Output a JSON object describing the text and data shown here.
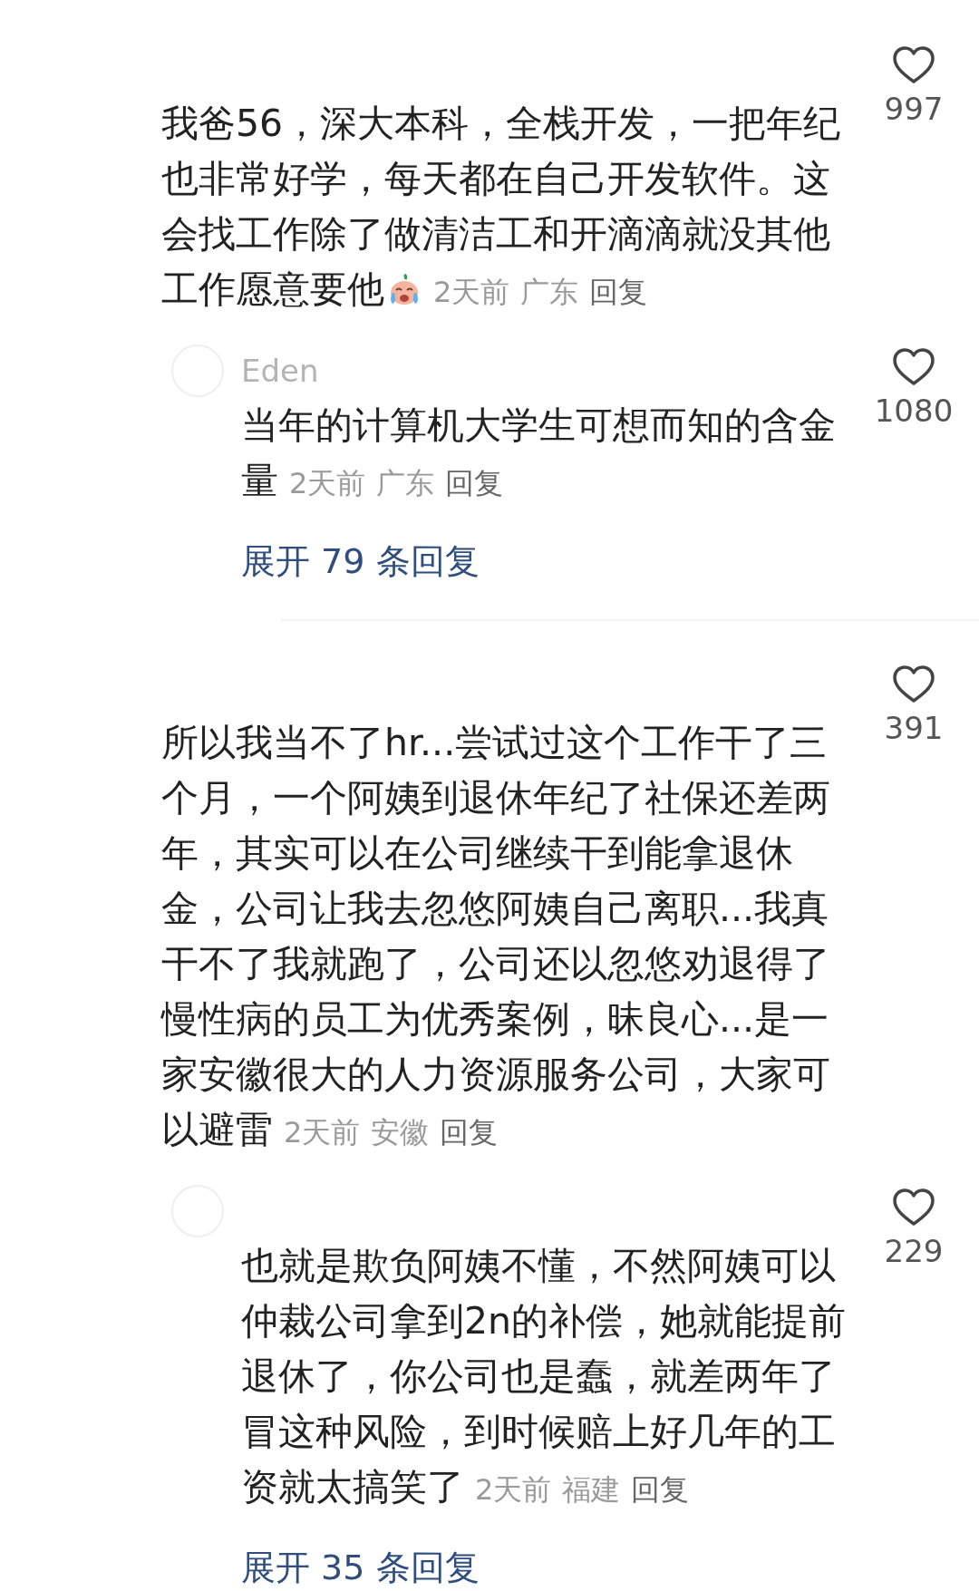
{
  "comments": [
    {
      "text": "我爸56，深大本科，全栈开发，一把年纪也非常好学，每天都在自己开发软件。这会找工作除了做清洁工和开滴滴就没其他工作愿意要他",
      "emoji": true,
      "time": "2天前",
      "region": "广东",
      "reply_label": "回复",
      "likes": "997",
      "replies": [
        {
          "username": "Eden",
          "text": "当年的计算机大学生可想而知的含金量",
          "time": "2天前",
          "region": "广东",
          "reply_label": "回复",
          "likes": "1080"
        }
      ],
      "expand_label": "展开 79 条回复"
    },
    {
      "text": "所以我当不了hr...尝试过这个工作干了三个月，一个阿姨到退休年纪了社保还差两年，其实可以在公司继续干到能拿退休金，公司让我去忽悠阿姨自己离职...我真干不了我就跑了，公司还以忽悠劝退得了慢性病的员工为优秀案例，昧良心...是一家安徽很大的人力资源服务公司，大家可以避雷",
      "emoji": false,
      "time": "2天前",
      "region": "安徽",
      "reply_label": "回复",
      "likes": "391",
      "replies": [
        {
          "text": "也就是欺负阿姨不懂，不然阿姨可以仲裁公司拿到2n的补偿，她就能提前退休了，你公司也是蠢，就差两年了冒这种风险，到时候赔上好几年的工资就太搞笑了",
          "time": "2天前",
          "region": "福建",
          "reply_label": "回复",
          "likes": "229"
        }
      ],
      "expand_label": "展开 35 条回复"
    }
  ]
}
